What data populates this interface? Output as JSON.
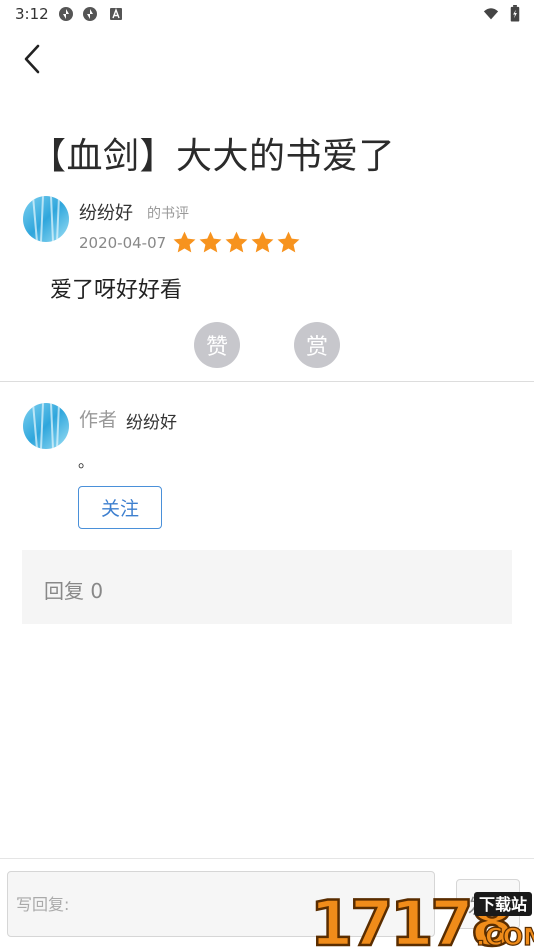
{
  "status_bar": {
    "time": "3:12",
    "icons": [
      "sync-icon",
      "sync-icon",
      "text-badge-icon",
      "wifi-icon",
      "battery-icon"
    ]
  },
  "nav": {
    "back_icon": "chevron-left-icon"
  },
  "title": "【血剑】大大的书爱了",
  "review": {
    "reviewer_name": "纷纷好",
    "tag": "的书评",
    "date": "2020-04-07",
    "rating": 5,
    "rating_max": 5,
    "content": "爱了呀好好看",
    "like_label": "赞",
    "reward_label": "赏"
  },
  "author": {
    "label": "作者",
    "name": "纷纷好",
    "bio": "。",
    "follow_label": "关注"
  },
  "replies": {
    "count_text": "回复 0"
  },
  "composer": {
    "placeholder": "写回复:",
    "value": "",
    "send_label": "发送"
  },
  "watermark": {
    "digits": "17178",
    "badge": "下载站",
    "domain": ".COM"
  },
  "colors": {
    "star": "#f7931e",
    "action_circle": "#c7c7cc",
    "follow_border": "#4a90d9",
    "reply_panel": "#f5f5f5",
    "watermark_orange": "#f08c1a"
  }
}
